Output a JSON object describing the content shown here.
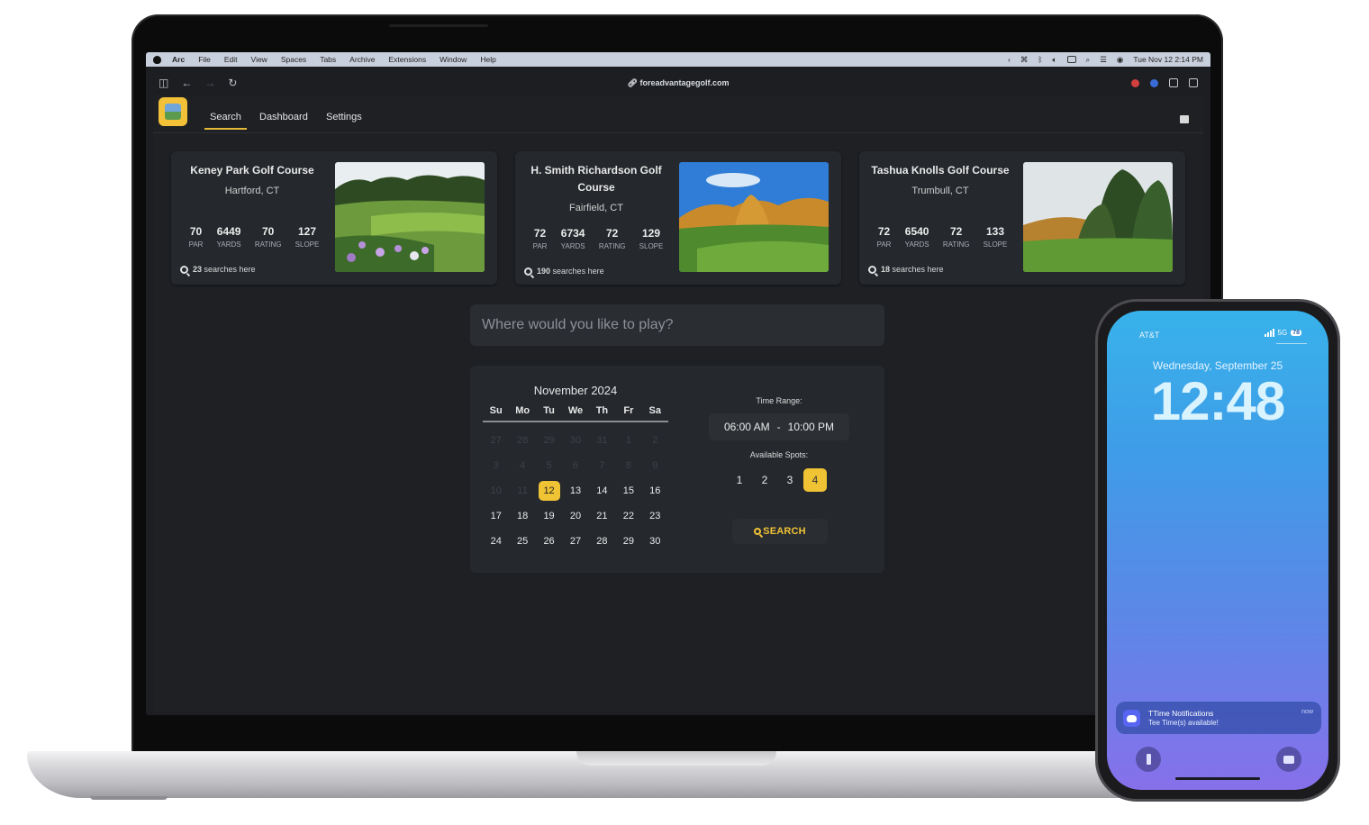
{
  "menubar": {
    "items": [
      "Arc",
      "File",
      "Edit",
      "View",
      "Spaces",
      "Tabs",
      "Archive",
      "Extensions",
      "Window",
      "Help"
    ],
    "clock": "Tue Nov 12  2:14 PM"
  },
  "browser": {
    "url": "foreadvantagegolf.com"
  },
  "nav": {
    "tabs": [
      "Search",
      "Dashboard",
      "Settings"
    ],
    "active_tab": "Search"
  },
  "courses": [
    {
      "name": "Keney Park Golf Course",
      "city": "Hartford, CT",
      "par": "70",
      "yards": "6449",
      "rating": "70",
      "slope": "127",
      "searches": "23",
      "searches_suffix": "searches here"
    },
    {
      "name": "H. Smith Richardson Golf Course",
      "city": "Fairfield, CT",
      "par": "72",
      "yards": "6734",
      "rating": "72",
      "slope": "129",
      "searches": "190",
      "searches_suffix": "searches here"
    },
    {
      "name": "Tashua Knolls Golf Course",
      "city": "Trumbull, CT",
      "par": "72",
      "yards": "6540",
      "rating": "72",
      "slope": "133",
      "searches": "18",
      "searches_suffix": "searches here"
    }
  ],
  "stat_labels": {
    "par": "PAR",
    "yards": "YARDS",
    "rating": "RATING",
    "slope": "SLOPE"
  },
  "search": {
    "placeholder": "Where would you like to play?"
  },
  "calendar": {
    "title": "November 2024",
    "weekdays": [
      "Su",
      "Mo",
      "Tu",
      "We",
      "Th",
      "Fr",
      "Sa"
    ],
    "days": [
      {
        "d": "27",
        "dim": true
      },
      {
        "d": "28",
        "dim": true
      },
      {
        "d": "29",
        "dim": true
      },
      {
        "d": "30",
        "dim": true
      },
      {
        "d": "31",
        "dim": true
      },
      {
        "d": "1",
        "dim": true
      },
      {
        "d": "2",
        "dim": true
      },
      {
        "d": "3",
        "dim": true
      },
      {
        "d": "4",
        "dim": true
      },
      {
        "d": "5",
        "dim": true
      },
      {
        "d": "6",
        "dim": true
      },
      {
        "d": "7",
        "dim": true
      },
      {
        "d": "8",
        "dim": true
      },
      {
        "d": "9",
        "dim": true
      },
      {
        "d": "10",
        "dim": true
      },
      {
        "d": "11",
        "dim": true
      },
      {
        "d": "12",
        "sel": true
      },
      {
        "d": "13"
      },
      {
        "d": "14"
      },
      {
        "d": "15"
      },
      {
        "d": "16"
      },
      {
        "d": "17"
      },
      {
        "d": "18"
      },
      {
        "d": "19"
      },
      {
        "d": "20"
      },
      {
        "d": "21"
      },
      {
        "d": "22"
      },
      {
        "d": "23"
      },
      {
        "d": "24"
      },
      {
        "d": "25"
      },
      {
        "d": "26"
      },
      {
        "d": "27"
      },
      {
        "d": "28"
      },
      {
        "d": "29"
      },
      {
        "d": "30"
      }
    ]
  },
  "time_range": {
    "label": "Time Range:",
    "start": "06:00 AM",
    "separator": "-",
    "end": "10:00 PM"
  },
  "spots": {
    "label": "Available Spots:",
    "options": [
      "1",
      "2",
      "3",
      "4"
    ],
    "selected": "4"
  },
  "search_button": "SEARCH",
  "phone": {
    "carrier": "AT&T",
    "network": "5G",
    "battery": "78",
    "date": "Wednesday, September 25",
    "time": "12:48",
    "notification": {
      "title": "TTime Notifications",
      "body": "Tee Time(s) available!",
      "time": "now"
    }
  },
  "colors": {
    "accent": "#f0c335",
    "background": "#1e2024",
    "card": "#25282d"
  }
}
